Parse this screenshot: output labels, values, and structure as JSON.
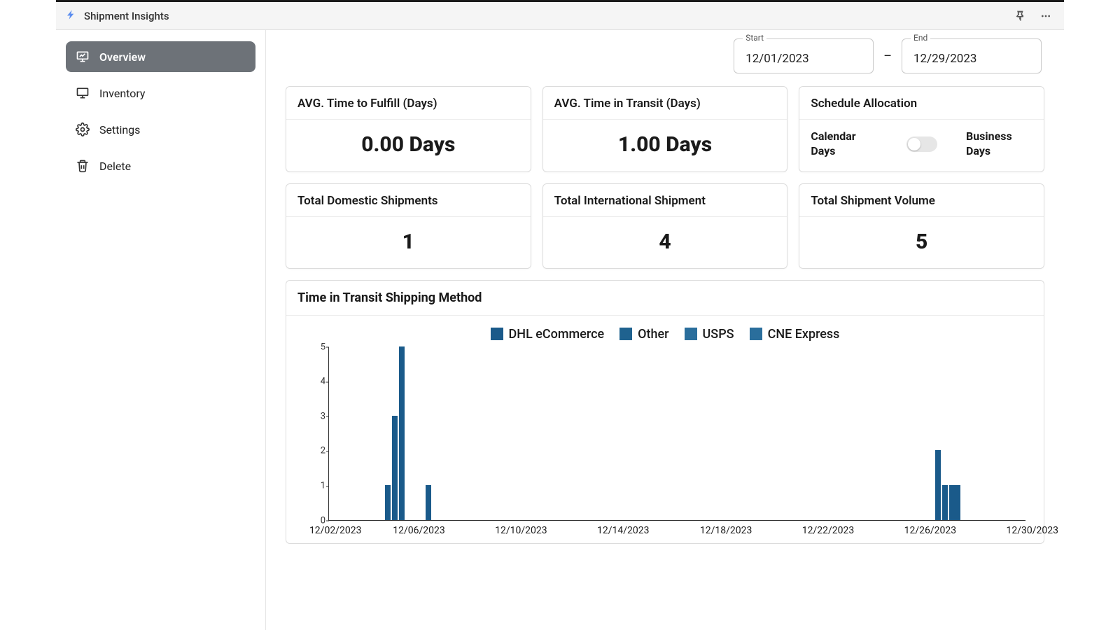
{
  "app": {
    "title": "Shipment Insights"
  },
  "sidebar": {
    "items": [
      {
        "label": "Overview",
        "icon": "presentation-chart-icon"
      },
      {
        "label": "Inventory",
        "icon": "monitor-icon"
      },
      {
        "label": "Settings",
        "icon": "gear-icon"
      },
      {
        "label": "Delete",
        "icon": "trash-icon"
      }
    ]
  },
  "date_range": {
    "start_label": "Start",
    "start_value": "12/01/2023",
    "dash": "–",
    "end_label": "End",
    "end_value": "12/29/2023"
  },
  "metrics": {
    "fulfill": {
      "title": "AVG. Time to Fulfill (Days)",
      "value": "0.00 Days"
    },
    "transit": {
      "title": "AVG. Time in Transit (Days)",
      "value": "1.00 Days"
    },
    "schedule": {
      "title": "Schedule Allocation",
      "left": "Calendar Days",
      "right": "Business Days"
    },
    "domestic": {
      "title": "Total Domestic Shipments",
      "value": "1"
    },
    "international": {
      "title": "Total International Shipment",
      "value": "4"
    },
    "volume": {
      "title": "Total Shipment Volume",
      "value": "5"
    }
  },
  "chart": {
    "title": "Time in Transit Shipping Method",
    "legend": [
      "DHL eCommerce",
      "Other",
      "USPS",
      "CNE Express"
    ]
  },
  "chart_data": {
    "type": "bar",
    "title": "Time in Transit Shipping Method",
    "xlabel": "",
    "ylabel": "",
    "ylim": [
      0,
      5
    ],
    "yticks": [
      0,
      1,
      2,
      3,
      4,
      5
    ],
    "x_tick_labels": [
      "12/02/2023",
      "12/06/2023",
      "12/10/2023",
      "12/14/2023",
      "12/18/2023",
      "12/22/2023",
      "12/26/2023",
      "12/30/2023"
    ],
    "x_tick_positions": [
      1,
      12.7,
      27,
      41.3,
      55.7,
      70,
      84.3,
      98.6
    ],
    "series_names": [
      "DHL eCommerce",
      "Other",
      "USPS",
      "CNE Express"
    ],
    "bars": [
      {
        "x": 8.0,
        "value": 1
      },
      {
        "x": 9.0,
        "value": 3
      },
      {
        "x": 10.0,
        "value": 5
      },
      {
        "x": 13.9,
        "value": 1
      },
      {
        "x": 87.0,
        "value": 2
      },
      {
        "x": 88.0,
        "value": 1
      },
      {
        "x": 89.0,
        "value": 1
      },
      {
        "x": 89.8,
        "value": 1
      }
    ]
  }
}
